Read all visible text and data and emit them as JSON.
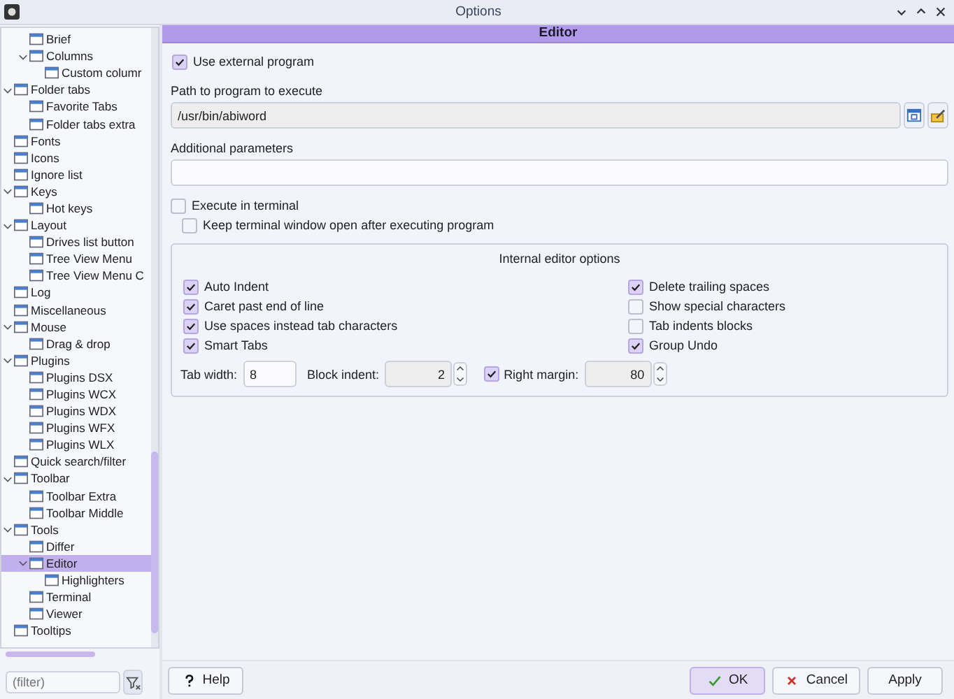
{
  "window": {
    "title": "Options"
  },
  "tree": {
    "continued": [
      {
        "label": "Brief",
        "selected": false
      },
      {
        "label": "Columns",
        "selected": false,
        "expanded": true,
        "children": [
          {
            "label": "Custom columr",
            "selected": false
          }
        ]
      }
    ],
    "items": [
      {
        "label": "Folder tabs",
        "selected": false,
        "expanded": true,
        "children": [
          {
            "label": "Favorite Tabs",
            "selected": false
          },
          {
            "label": "Folder tabs extra",
            "selected": false
          }
        ]
      },
      {
        "label": "Fonts",
        "selected": false
      },
      {
        "label": "Icons",
        "selected": false
      },
      {
        "label": "Ignore list",
        "selected": false
      },
      {
        "label": "Keys",
        "selected": false,
        "expanded": true,
        "children": [
          {
            "label": "Hot keys",
            "selected": false
          }
        ]
      },
      {
        "label": "Layout",
        "selected": false,
        "expanded": true,
        "children": [
          {
            "label": "Drives list button",
            "selected": false
          },
          {
            "label": "Tree View Menu",
            "selected": false
          },
          {
            "label": "Tree View Menu C",
            "selected": false
          }
        ]
      },
      {
        "label": "Log",
        "selected": false
      },
      {
        "label": "Miscellaneous",
        "selected": false
      },
      {
        "label": "Mouse",
        "selected": false,
        "expanded": true,
        "children": [
          {
            "label": "Drag & drop",
            "selected": false
          }
        ]
      },
      {
        "label": "Plugins",
        "selected": false,
        "expanded": true,
        "children": [
          {
            "label": "Plugins DSX",
            "selected": false
          },
          {
            "label": "Plugins WCX",
            "selected": false
          },
          {
            "label": "Plugins WDX",
            "selected": false
          },
          {
            "label": "Plugins WFX",
            "selected": false
          },
          {
            "label": "Plugins WLX",
            "selected": false
          }
        ]
      },
      {
        "label": "Quick search/filter",
        "selected": false
      },
      {
        "label": "Toolbar",
        "selected": false,
        "expanded": true,
        "children": [
          {
            "label": "Toolbar Extra",
            "selected": false
          },
          {
            "label": "Toolbar Middle",
            "selected": false
          }
        ]
      },
      {
        "label": "Tools",
        "selected": false,
        "expanded": true,
        "children": [
          {
            "label": "Differ",
            "selected": false
          },
          {
            "label": "Editor",
            "selected": true,
            "expanded": true,
            "children": [
              {
                "label": "Highlighters",
                "selected": false
              }
            ]
          },
          {
            "label": "Terminal",
            "selected": false
          },
          {
            "label": "Viewer",
            "selected": false
          }
        ]
      },
      {
        "label": "Tooltips",
        "selected": false
      }
    ]
  },
  "filter": {
    "placeholder": "(filter)"
  },
  "page": {
    "header": "Editor",
    "use_external": {
      "label": "Use external program",
      "checked": true
    },
    "path": {
      "label": "Path to program to execute",
      "value": "/usr/bin/abiword",
      "disabled": true
    },
    "params": {
      "label": "Additional parameters"
    },
    "exec_terminal": {
      "label": "Execute in terminal",
      "checked": false
    },
    "keep_open": {
      "label": "Keep terminal window open after executing program",
      "checked": false
    },
    "group": {
      "title": "Internal editor options",
      "left": [
        {
          "label": "Auto Indent",
          "checked": true
        },
        {
          "label": "Caret past end of line",
          "checked": true
        },
        {
          "label": "Use spaces instead tab characters",
          "checked": true
        },
        {
          "label": "Smart Tabs",
          "checked": true
        }
      ],
      "right": [
        {
          "label": "Delete trailing spaces",
          "checked": true
        },
        {
          "label": "Show special characters",
          "checked": false
        },
        {
          "label": "Tab indents blocks",
          "checked": false
        },
        {
          "label": "Group Undo",
          "checked": true
        }
      ]
    },
    "tab_width": {
      "label": "Tab width:",
      "value": "8",
      "disabled": false
    },
    "block_indent": {
      "label": "Block indent:",
      "value": "2",
      "disabled": true
    },
    "right_margin": {
      "label": "Right margin:",
      "value": "80",
      "checked": true,
      "disabled": true
    }
  },
  "buttons": [
    {
      "label": "Help",
      "kind": "help",
      "default": false
    },
    {
      "label": "OK",
      "kind": "ok",
      "default": true
    },
    {
      "label": "Cancel",
      "kind": "cancel",
      "default": false
    },
    {
      "label": "Apply",
      "kind": "apply",
      "default": false
    }
  ]
}
